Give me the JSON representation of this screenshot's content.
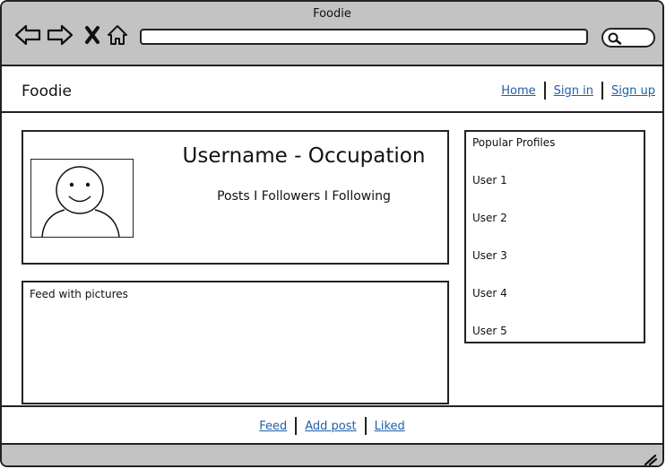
{
  "window": {
    "title": "Foodie"
  },
  "browser": {
    "icons": [
      "back-arrow-icon",
      "forward-arrow-icon",
      "close-x-icon",
      "home-icon",
      "search-icon",
      "resize-handle-icon"
    ],
    "address_value": "",
    "search_value": ""
  },
  "header": {
    "brand": "Foodie",
    "links": [
      "Home",
      "Sign in",
      "Sign up"
    ]
  },
  "profile": {
    "title": "Username - Occupation",
    "stats": "Posts I Followers I Following",
    "avatar_icon": "smiley-face-icon"
  },
  "feed": {
    "label": "Feed with pictures"
  },
  "popular": {
    "title": "Popular Profiles",
    "users": [
      "User 1",
      "User 2",
      "User 3",
      "User 4",
      "User 5"
    ]
  },
  "footer": {
    "links": [
      "Feed",
      "Add post",
      "Liked"
    ]
  },
  "colors": {
    "chrome": "#c3c3c3",
    "link": "#1f5fa8",
    "border": "#222222"
  }
}
